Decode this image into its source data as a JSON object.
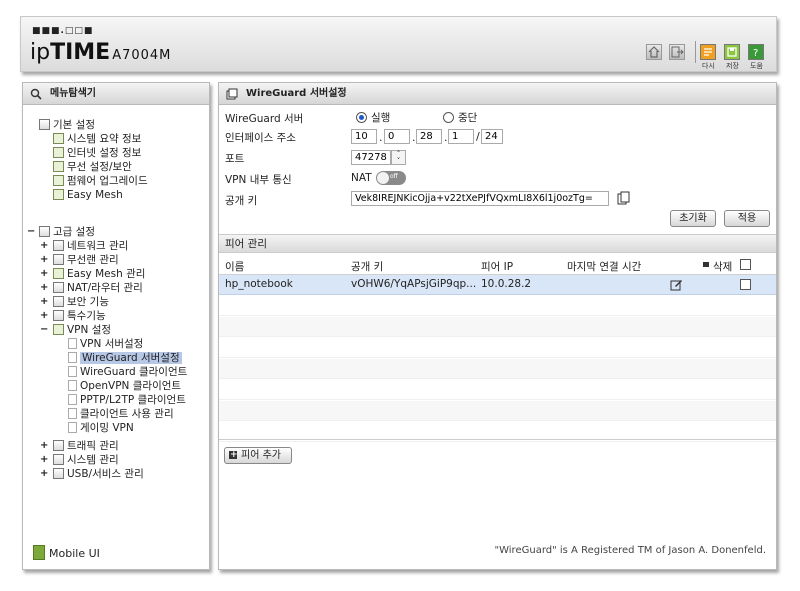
{
  "header": {
    "logo_dots": "■■■.□□■",
    "logo_brand_a": "ip",
    "logo_brand_b": "TIME",
    "logo_model": "A7004M",
    "buttons": [
      {
        "label": "다시",
        "color": "#f0a020"
      },
      {
        "label": "저장",
        "color": "#8cc63f"
      },
      {
        "label": "도움",
        "color": "#3a9a3a"
      }
    ]
  },
  "sidebar": {
    "title": "메뉴탐색기",
    "basic_group": "기본 설정",
    "basic_items": [
      "시스템 요약 정보",
      "인터넷 설정 정보",
      "무선 설정/보안",
      "펌웨어 업그레이드",
      "Easy Mesh"
    ],
    "advanced_group": "고급 설정",
    "advanced_items": [
      "네트워크 관리",
      "무선랜 관리",
      "Easy Mesh 관리",
      "NAT/라우터 관리",
      "보안 기능",
      "특수기능",
      "VPN 설정"
    ],
    "vpn_items": [
      "VPN 서버설정",
      "WireGuard 서버설정",
      "WireGuard 클라이언트",
      "OpenVPN 클라이언트",
      "PPTP/L2TP 클라이언트",
      "클라이언트 사용 관리",
      "게이밍 VPN"
    ],
    "after_items": [
      "트래픽 관리",
      "시스템 관리",
      "USB/서비스 관리"
    ],
    "mobile_ui": "Mobile UI"
  },
  "main": {
    "title": "WireGuard 서버설정",
    "server_label": "WireGuard 서버",
    "run_label": "실행",
    "stop_label": "중단",
    "iface_label": "인터페이스 주소",
    "ip": [
      "10",
      "0",
      "28",
      "1"
    ],
    "mask": "24",
    "port_label": "포트",
    "port": "47278",
    "vpn_internal_label": "VPN 내부 통신",
    "nat_label": "NAT",
    "toggle_text": "off",
    "pubkey_label": "공개 키",
    "pubkey": "Vek8IREJNKicOjja+v22tXePJfVQxmLI8X6l1j0ozTg=",
    "reset_btn": "초기화",
    "apply_btn": "적용",
    "peer_section": "피어 관리",
    "col_name": "이름",
    "col_pubkey": "공개 키",
    "col_peer_ip": "피어 IP",
    "col_last_conn": "마지막 연결 시간",
    "col_delete": "삭제",
    "peers": [
      {
        "name": "hp_notebook",
        "pubkey": "vOHW6/YqAPsjGiP9qp...",
        "ip": "10.0.28.2",
        "last": ""
      }
    ],
    "add_peer_btn": "피어 추가",
    "footer": "\"WireGuard\" is A Registered TM of Jason A. Donenfeld."
  }
}
